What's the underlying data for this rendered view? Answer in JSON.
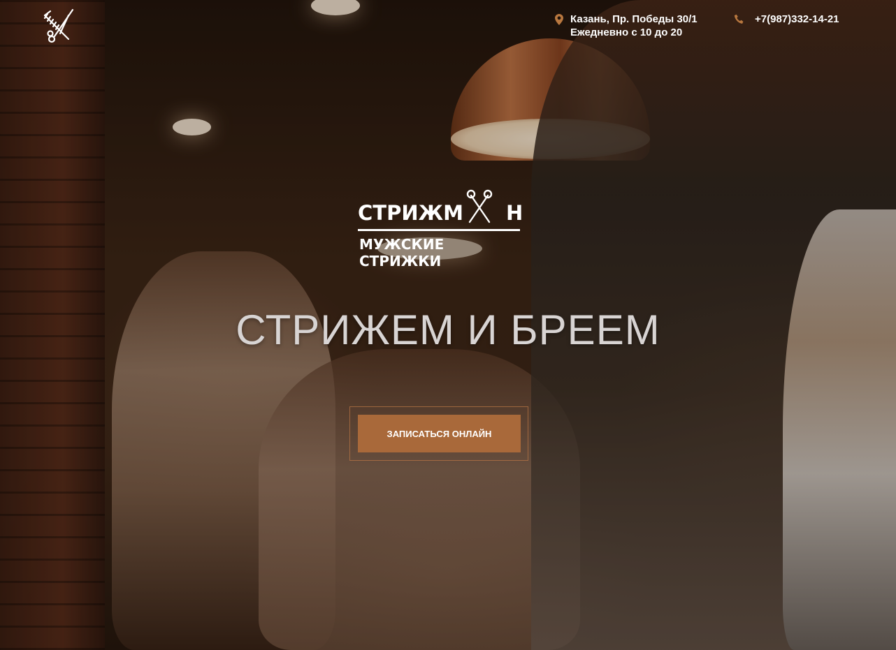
{
  "header": {
    "address_line1": "Казань, Пр. Победы 30/1",
    "address_line2": "Ежедневно с 10 до 20",
    "phone": "+7(987)332-14-21"
  },
  "brand": {
    "name_part1": "СТРИЖМ",
    "name_part2": "Н",
    "tagline": "МУЖСКИЕ СТРИЖКИ"
  },
  "hero": {
    "headline": "СТРИЖЕМ И БРЕЕМ",
    "cta_label": "ЗАПИСАТЬСЯ ОНЛАЙН"
  },
  "colors": {
    "accent": "#a9693a",
    "icon_accent": "#b9783f",
    "text": "#ffffff"
  },
  "icons": [
    "comb-scissors-icon",
    "location-pin-icon",
    "phone-icon",
    "scissors-icon"
  ]
}
